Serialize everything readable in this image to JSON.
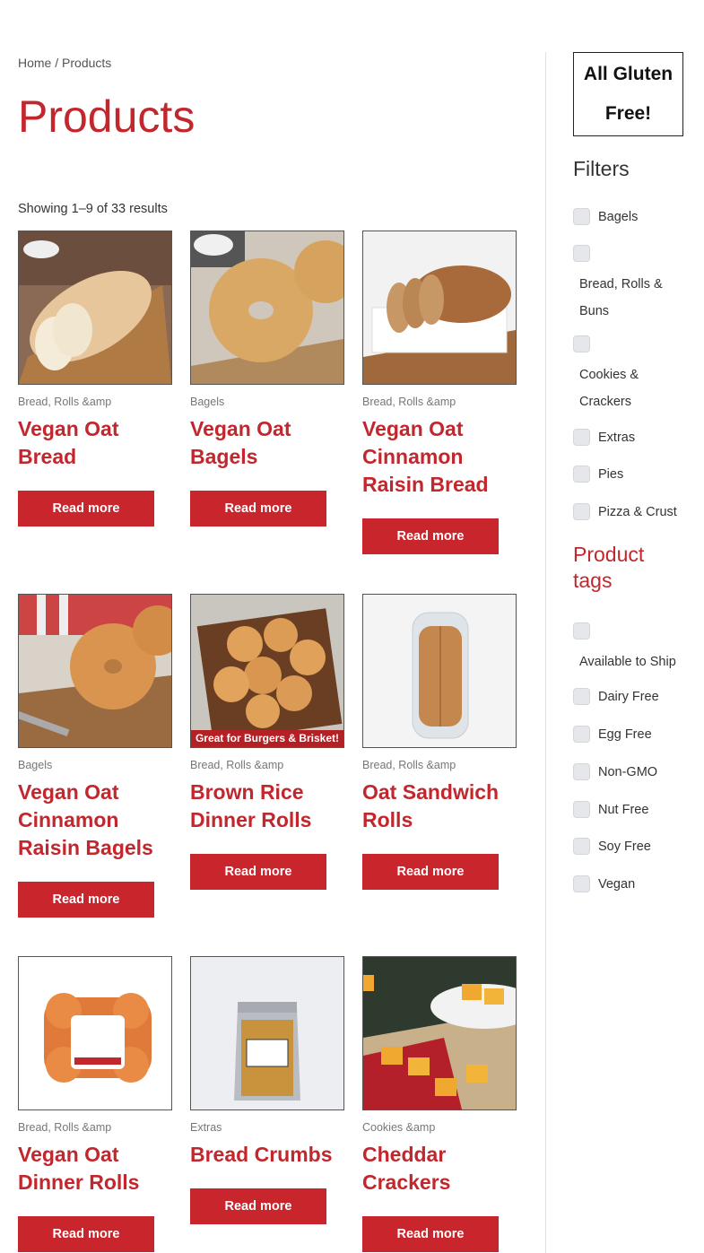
{
  "breadcrumb": {
    "home": "Home",
    "sep": "/",
    "current": "Products"
  },
  "page_title": "Products",
  "result_count": "Showing 1–9 of 33 results",
  "products": [
    {
      "category": "Bread, Rolls &amp",
      "name": "Vegan Oat Bread",
      "button": "Read more"
    },
    {
      "category": "Bagels",
      "name": "Vegan Oat Bagels",
      "button": "Read more"
    },
    {
      "category": "Bread, Rolls &amp",
      "name": "Vegan Oat Cinnamon Raisin Bread",
      "button": "Read more"
    },
    {
      "category": "Bagels",
      "name": "Vegan Oat Cinnamon Raisin Bagels",
      "button": "Read more"
    },
    {
      "category": "Bread, Rolls &amp",
      "name": "Brown Rice Dinner Rolls",
      "button": "Read more",
      "banner": "Great for Burgers & Brisket!"
    },
    {
      "category": "Bread, Rolls &amp",
      "name": "Oat Sandwich Rolls",
      "button": "Read more"
    },
    {
      "category": "Bread, Rolls &amp",
      "name": "Vegan Oat Dinner Rolls",
      "button": "Read more"
    },
    {
      "category": "Extras",
      "name": "Bread Crumbs",
      "button": "Read more"
    },
    {
      "category": "Cookies &amp",
      "name": "Cheddar Crackers",
      "button": "Read more"
    }
  ],
  "sidebar": {
    "promo_line1": "All Gluten",
    "promo_line2": "Free!",
    "filters_title": "Filters",
    "filters": [
      "Bagels",
      "Bread, Rolls & Buns",
      "Cookies & Crackers",
      "Extras",
      "Pies",
      "Pizza & Crust"
    ],
    "tags_title": "Product tags",
    "tags": [
      "Available to Ship",
      "Dairy Free",
      "Egg Free",
      "Non-GMO",
      "Nut Free",
      "Soy Free",
      "Vegan"
    ]
  },
  "colors": {
    "accent": "#c2272d",
    "button": "#c9252c",
    "checkbox": "#e5e7ea"
  }
}
